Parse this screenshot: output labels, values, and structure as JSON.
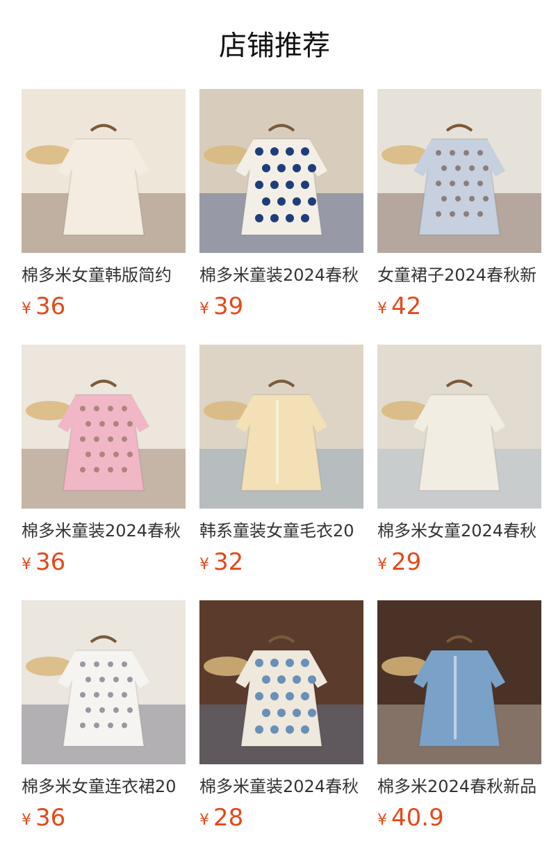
{
  "header": {
    "title": "店铺推荐"
  },
  "colors": {
    "price": "#e4491a",
    "title": "#111111",
    "name": "#333333"
  },
  "products": [
    {
      "name": "棉多米女童韩版简约",
      "currency": "¥",
      "price": "36",
      "image": "cream-dress-photo",
      "palette": [
        "#efe6da",
        "#f4ece0",
        "#6b4a37"
      ]
    },
    {
      "name": "棉多米童装2024春秋",
      "currency": "¥",
      "price": "39",
      "image": "polka-dot-dress-photo",
      "palette": [
        "#d8cdbd",
        "#f4efe6",
        "#1f3d7a"
      ]
    },
    {
      "name": "女童裙子2024春秋新",
      "currency": "¥",
      "price": "42",
      "image": "floral-blue-dress-photo",
      "palette": [
        "#e6e2da",
        "#c6d0df",
        "#5a3a2b"
      ]
    },
    {
      "name": "棉多米童装2024春秋",
      "currency": "¥",
      "price": "36",
      "image": "pink-floral-dress-photo",
      "palette": [
        "#ece6dc",
        "#f1b7c6",
        "#7a5a43"
      ]
    },
    {
      "name": "韩系童装女童毛衣20",
      "currency": "¥",
      "price": "32",
      "image": "sweater-and-jeans-photo",
      "palette": [
        "#ddd4c6",
        "#f3e0b6",
        "#6f8fae"
      ]
    },
    {
      "name": "棉多米女童2024春秋",
      "currency": "¥",
      "price": "29",
      "image": "lace-overdress-photo",
      "palette": [
        "#e2dbd0",
        "#f2ede2",
        "#9bb3c6"
      ]
    },
    {
      "name": "棉多米女童连衣裙20",
      "currency": "¥",
      "price": "36",
      "image": "floral-slip-dress-photo",
      "palette": [
        "#ebe6de",
        "#f6f4f0",
        "#4b4a63"
      ]
    },
    {
      "name": "棉多米童装2024春秋",
      "currency": "¥",
      "price": "28",
      "image": "polka-dot-pants-photo",
      "palette": [
        "#5a3b2c",
        "#efe8dc",
        "#6a8fb8"
      ]
    },
    {
      "name": "棉多米2024春秋新品",
      "currency": "¥",
      "price": "40.9",
      "image": "denim-jacket-photo",
      "palette": [
        "#4a3226",
        "#7aa2c8",
        "#f1ebe0"
      ]
    }
  ]
}
